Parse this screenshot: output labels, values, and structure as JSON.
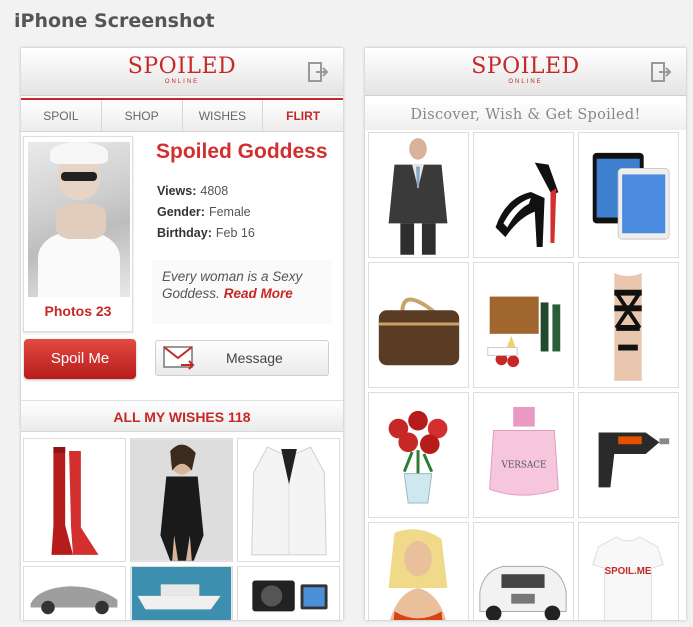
{
  "page_heading": "iPhone Screenshot",
  "logo": {
    "main": "SPOILED",
    "sub": "ONLINE"
  },
  "colors": {
    "brand_red": "#c62828",
    "text_gray": "#555555"
  },
  "left_screen": {
    "tabs": [
      {
        "label": "SPOIL",
        "active": false
      },
      {
        "label": "SHOP",
        "active": false
      },
      {
        "label": "WISHES",
        "active": false
      },
      {
        "label": "FLIRT",
        "active": true
      }
    ],
    "profile": {
      "name": "Spoiled Goddess",
      "photos_label": "Photos 23",
      "stats": [
        {
          "key": "Views:",
          "value": "4808"
        },
        {
          "key": "Gender:",
          "value": "Female"
        },
        {
          "key": "Birthday:",
          "value": "Feb 16"
        }
      ],
      "bio": "Every woman is a Sexy Goddess.",
      "read_more": "Read More"
    },
    "buttons": {
      "spoil": "Spoil Me",
      "message": "Message"
    },
    "wishes_header": "ALL MY WISHES 118",
    "wish_items": [
      "red-boots",
      "black-dress",
      "white-blazer",
      "silver-sports-car",
      "yacht",
      "camera-gadgets"
    ]
  },
  "right_screen": {
    "banner": "Discover, Wish & Get Spoiled!",
    "products": [
      {
        "icon": "suit-icon"
      },
      {
        "icon": "high-heels-icon"
      },
      {
        "icon": "tablet-icon"
      },
      {
        "icon": "handbag-icon"
      },
      {
        "icon": "picnic-basket-icon"
      },
      {
        "icon": "swimsuit-icon"
      },
      {
        "icon": "roses-icon"
      },
      {
        "icon": "perfume-icon",
        "label": "VERSACE"
      },
      {
        "icon": "drill-icon"
      },
      {
        "icon": "model-icon"
      },
      {
        "icon": "white-car-icon"
      },
      {
        "icon": "tshirt-icon",
        "label": "SPOIL.ME"
      }
    ]
  }
}
